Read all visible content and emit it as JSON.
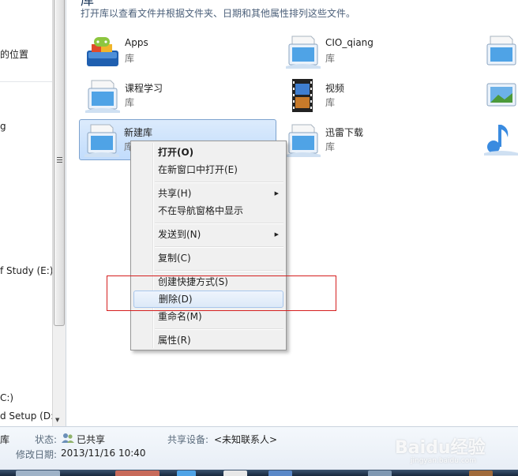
{
  "nav": {
    "items": [
      "的位置",
      "g",
      "f Study (E:)",
      "C:)",
      "d Setup (D:"
    ]
  },
  "content": {
    "heading": "库",
    "description": "打开库以查看文件并根据文件夹、日期和其他属性排列这些文件。",
    "items": [
      {
        "name": "Apps",
        "type": "库",
        "icon": "apps-library-icon"
      },
      {
        "name": "CIO_qiang",
        "type": "库",
        "icon": "library-icon"
      },
      {
        "name": "课程学习",
        "type": "库",
        "icon": "library-icon"
      },
      {
        "name": "视频",
        "type": "库",
        "icon": "videos-library-icon"
      },
      {
        "name": "新建库",
        "type": "库",
        "icon": "library-icon"
      },
      {
        "name": "迅雷下载",
        "type": "库",
        "icon": "library-icon"
      }
    ]
  },
  "context_menu": {
    "open": "打开(O)",
    "open_new_window": "在新窗口中打开(E)",
    "share": "共享(H)",
    "hide_in_nav": "不在导航窗格中显示",
    "send_to": "发送到(N)",
    "copy": "复制(C)",
    "create_shortcut": "创建快捷方式(S)",
    "delete": "删除(D)",
    "rename": "重命名(M)",
    "properties": "属性(R)"
  },
  "details": {
    "name": "库",
    "status_label": "状态:",
    "status_value": "已共享",
    "shared_with_label": "共享设备:",
    "shared_with_value": "<未知联系人>",
    "modified_label": "修改日期:",
    "modified_value": "2013/11/16 10:40"
  },
  "watermark": {
    "text": "Baidu经验",
    "url": "jingyan.baidu.com"
  },
  "colors": {
    "selection_bg": "#c1dcfc",
    "selection_border": "#7da2ce",
    "highlight_box": "#d51f1f",
    "menu_bg": "#f0f0f0"
  }
}
